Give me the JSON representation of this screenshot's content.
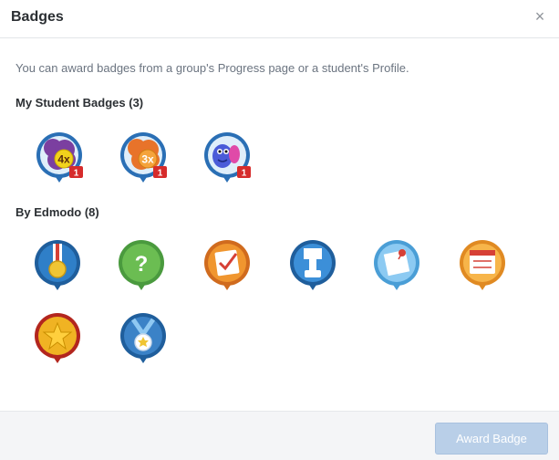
{
  "dialog": {
    "title": "Badges",
    "close_label": "×",
    "info_text": "You can award badges from a group's Progress page or a student's Profile."
  },
  "sections": {
    "student": {
      "title": "My Student Badges (3)"
    },
    "edmodo": {
      "title": "By Edmodo (8)"
    }
  },
  "student_badges": [
    {
      "icon": "purple-4x-badge-icon",
      "label": "4x",
      "count": "1",
      "color": "#7b3fa0"
    },
    {
      "icon": "orange-3x-badge-icon",
      "label": "3x",
      "count": "1",
      "color": "#e8732a"
    },
    {
      "icon": "blue-monster-badge-icon",
      "label": "",
      "count": "1",
      "color": "#4a5bd8"
    }
  ],
  "edmodo_badges": [
    {
      "icon": "medal-badge-icon",
      "color": "#1f5e9c"
    },
    {
      "icon": "question-badge-icon",
      "color": "#5aa84a"
    },
    {
      "icon": "checklist-badge-icon",
      "color": "#e0822a"
    },
    {
      "icon": "raised-hand-badge-icon",
      "color": "#2a78c2"
    },
    {
      "icon": "pinned-note-badge-icon",
      "color": "#5aaee0"
    },
    {
      "icon": "calendar-badge-icon",
      "color": "#f0a43a"
    },
    {
      "icon": "gold-star-badge-icon",
      "color": "#c0392b"
    },
    {
      "icon": "star-medal-badge-icon",
      "color": "#1f5e9c"
    }
  ],
  "footer": {
    "award_button": "Award Badge"
  }
}
